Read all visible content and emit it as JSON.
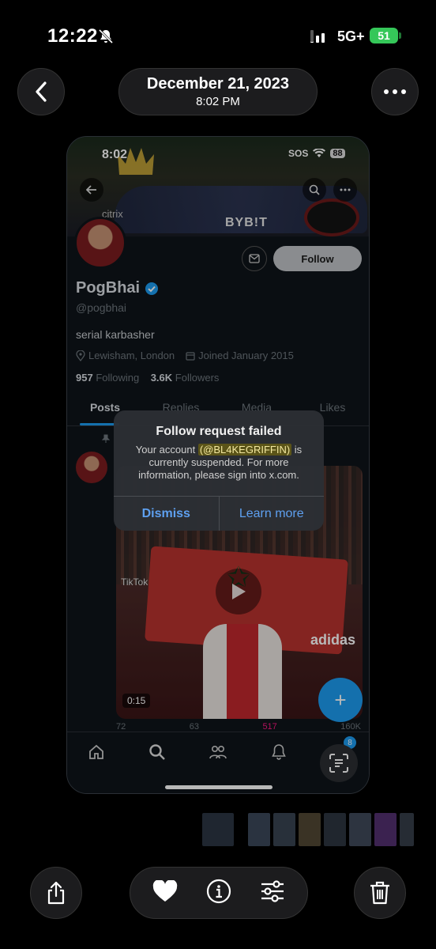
{
  "status_bar": {
    "time": "12:22",
    "network": "5G+",
    "battery": "51"
  },
  "viewer": {
    "date": "December 21, 2023",
    "time": "8:02 PM"
  },
  "screenshot": {
    "status_bar": {
      "time": "8:02",
      "sos": "SOS",
      "battery": "88"
    },
    "banner": {
      "sponsor": "BYB!T",
      "sponsor2": "citrix"
    },
    "profile": {
      "name": "PogBhai",
      "handle": "@pogbhai",
      "bio": "serial karbasher",
      "location": "Lewisham, London",
      "joined": "Joined January 2015",
      "following_count": "957",
      "following_label": "Following",
      "followers_count": "3.6K",
      "followers_label": "Followers",
      "follow_label": "Follow"
    },
    "tabs": [
      "Posts",
      "Replies",
      "Media",
      "Likes"
    ],
    "post": {
      "tiktok": "TikTok",
      "duration": "0:15",
      "adidas": "adidas",
      "replies": "72",
      "reposts": "63",
      "likes": "517",
      "views": "160K"
    },
    "nav_badge": "8",
    "alert": {
      "title": "Follow request failed",
      "body_pre": "Your account",
      "account": "(@BL4KEGRIFFIN)",
      "body_post": "is currently suspended. For more information, please sign into x.com.",
      "dismiss": "Dismiss",
      "learn_more": "Learn more"
    }
  },
  "colors": {
    "accent": "#1d9bf0",
    "alert_button": "#5ea0f0",
    "battery_green": "#35c759"
  }
}
